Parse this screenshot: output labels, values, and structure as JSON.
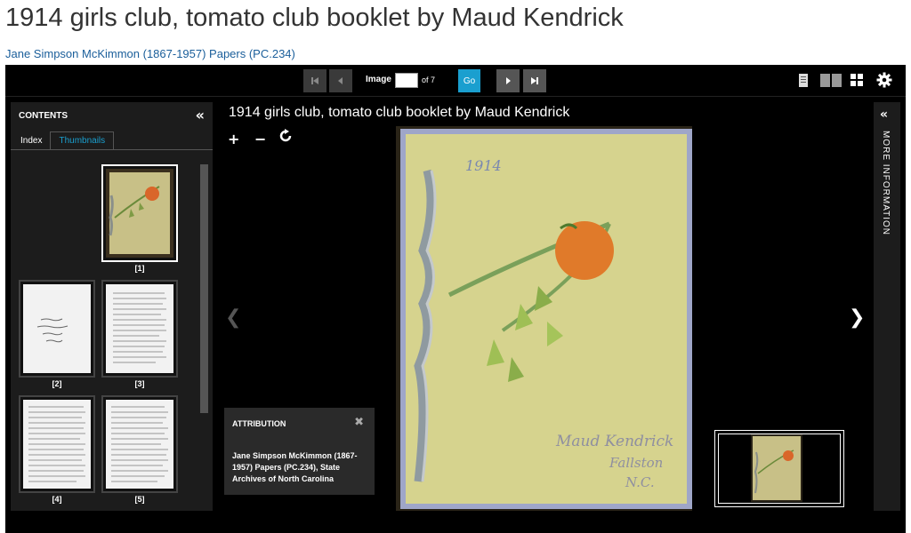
{
  "page": {
    "title": "1914 girls club, tomato club booklet by Maud Kendrick",
    "collection_link": "Jane Simpson McKimmon (1867-1957) Papers (PC.234)"
  },
  "toolbar": {
    "image_label": "Image",
    "image_input_value": "",
    "of_label": "of 7",
    "go_label": "Go",
    "first_icon": "skip-first-icon",
    "prev_icon": "prev-icon",
    "next_icon": "next-icon",
    "last_icon": "skip-last-icon",
    "view_single_icon": "single-page-icon",
    "view_double_icon": "two-page-icon",
    "view_grid_icon": "grid-view-icon",
    "settings_icon": "gear-icon"
  },
  "sidebar": {
    "heading": "CONTENTS",
    "collapse_icon": "double-chevron-left-icon",
    "tabs": [
      {
        "label": "Index"
      },
      {
        "label": "Thumbnails"
      }
    ],
    "thumbnails": [
      {
        "label": "[1]"
      },
      {
        "label": "[2]"
      },
      {
        "label": "[3]"
      },
      {
        "label": "[4]"
      },
      {
        "label": "[5]"
      }
    ]
  },
  "main": {
    "title": "1914 girls club, tomato club booklet by Maud Kendrick",
    "zoom_in": "+",
    "zoom_out": "−",
    "rotate_icon": "rotate-icon",
    "prev_icon": "chevron-left-icon",
    "next_icon": "chevron-right-icon",
    "cover_image": "tomato-club-booklet-cover"
  },
  "attribution": {
    "heading": "ATTRIBUTION",
    "close": "✖",
    "text": "Jane Simpson McKimmon (1867-1957) Papers (PC.234), State Archives of North Carolina"
  },
  "more_panel": {
    "collapse_icon": "double-chevron-left-icon",
    "label": "MORE INFORMATION"
  },
  "colors": {
    "accent": "#1a9fcf",
    "link": "#1a5e9a",
    "viewer_bg": "#000000",
    "panel_bg": "#1c1c1c"
  }
}
